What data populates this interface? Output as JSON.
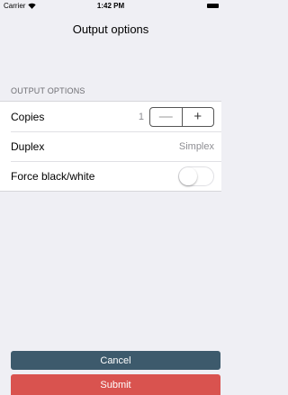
{
  "status_bar": {
    "carrier": "Carrier",
    "time": "1:42 PM",
    "wifi_icon": "wifi-icon",
    "battery_icon": "battery-icon"
  },
  "nav": {
    "title": "Output options"
  },
  "section": {
    "header": "OUTPUT OPTIONS"
  },
  "rows": {
    "copies": {
      "label": "Copies",
      "value": "1",
      "minus": "—",
      "plus": "+"
    },
    "duplex": {
      "label": "Duplex",
      "value": "Simplex"
    },
    "force_bw": {
      "label": "Force black/white",
      "on": false
    }
  },
  "buttons": {
    "cancel": "Cancel",
    "submit": "Submit"
  },
  "colors": {
    "background": "#efeff4",
    "cancel": "#3d5a6c",
    "submit": "#d9534f"
  }
}
